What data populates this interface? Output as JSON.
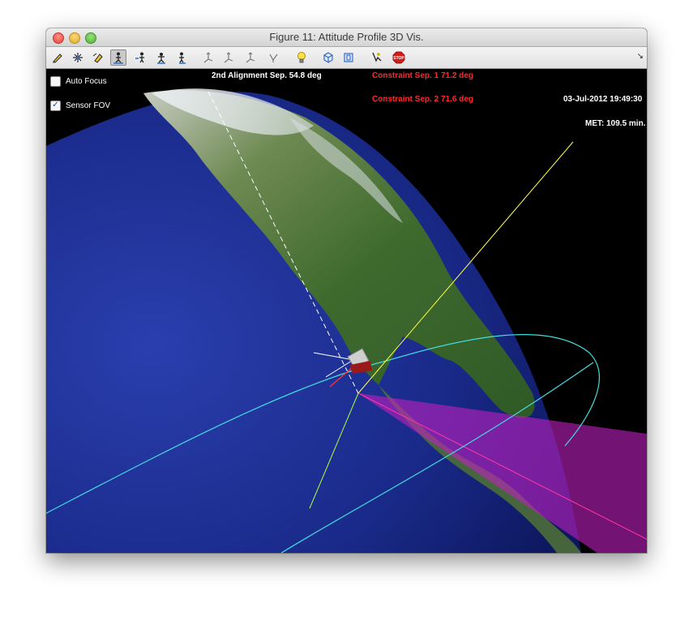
{
  "window": {
    "title": "Figure 11: Attitude Profile 3D Vis."
  },
  "toolbar": {
    "tools": [
      {
        "name": "pencil-icon"
      },
      {
        "name": "sparkle-icon"
      },
      {
        "name": "marker-icon"
      },
      {
        "name": "person-align-icon"
      },
      {
        "name": "person-left-icon"
      },
      {
        "name": "person-stand-icon"
      },
      {
        "name": "person-right-icon"
      },
      {
        "name": "axis-icon"
      },
      {
        "name": "axis-icon"
      },
      {
        "name": "axis-icon"
      },
      {
        "name": "axis-icon"
      },
      {
        "name": "lightbulb-icon"
      },
      {
        "name": "cube-icon"
      },
      {
        "name": "box-icon"
      },
      {
        "name": "cursor-add-icon"
      },
      {
        "name": "stop-icon"
      }
    ],
    "stop_label": "STOP"
  },
  "controls": {
    "auto_focus": {
      "label": "Auto Focus",
      "checked": false
    },
    "sensor_fov": {
      "label": "Sensor FOV",
      "checked": true
    }
  },
  "overlay": {
    "alignment": "2nd Alignment Sep. 54.8 deg",
    "constraint1": "Constraint Sep. 1 71.2 deg",
    "constraint2": "Constraint Sep. 2 71.6 deg",
    "datetime": "03-Jul-2012 19:49:30",
    "met": "MET: 109.5 min."
  },
  "colors": {
    "constraint_text": "#ff2a2a",
    "overlay_text": "#ffffff",
    "fov": "#c020c0",
    "orbit": "#44dddd",
    "boresight": "#ffff44",
    "alignment_line": "#ffffff"
  }
}
